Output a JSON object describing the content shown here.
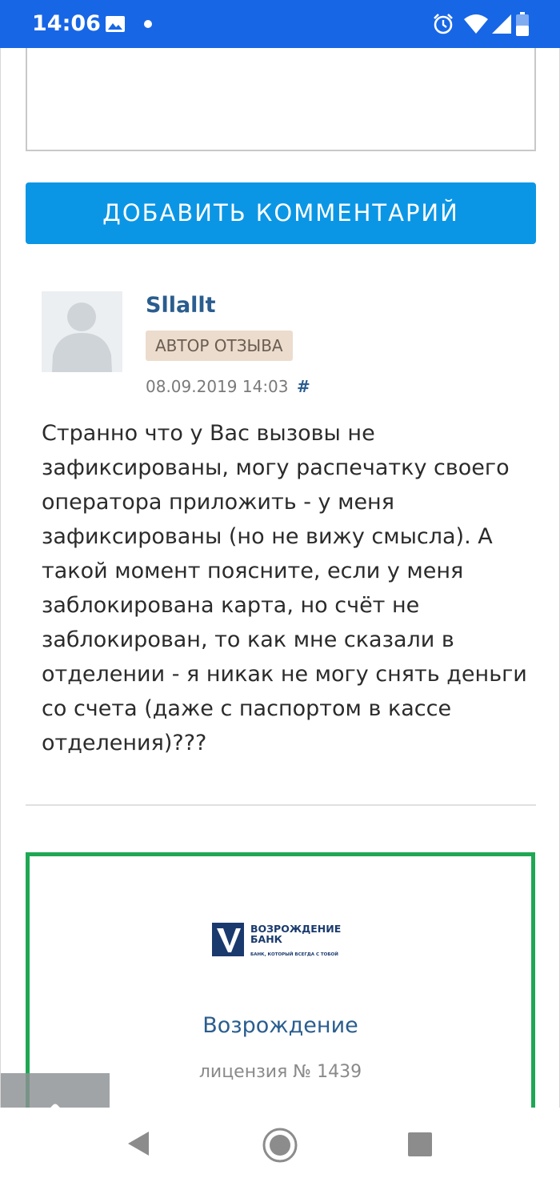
{
  "status_bar": {
    "time": "14:06",
    "background_color": "#1766e6"
  },
  "actions": {
    "add_comment_label": "ДОБАВИТЬ КОММЕНТАРИЙ",
    "button_color": "#0b96e5"
  },
  "comment": {
    "author": "Sllallt",
    "badge": "АВТОР ОТЗЫВА",
    "date": "08.09.2019 14:03",
    "anchor": "#",
    "text_lines": [
      "Странно что у Вас вызовы не",
      "зафиксированы, могу распечатку своего",
      "оператора приложить - у меня",
      "зафиксированы (но не вижу смысла). А",
      "такой момент поясните, если у меня",
      "заблокирована карта, но счёт не",
      "заблокирован, то как мне сказали в",
      "отделении - я никак не могу снять деньги",
      "со счета (даже с паспортом в кассе",
      "отделения)???"
    ]
  },
  "bank": {
    "logo_text_line1": "ВОЗРОЖДЕНИЕ",
    "logo_text_line2": "БАНК",
    "logo_tagline": "БАНК, КОТОРЫЙ ВСЕГДА С ТОБОЙ",
    "name": "Возрождение",
    "license": "лицензия № 1439",
    "border_color": "#1fa754"
  },
  "icons": {
    "scroll_top": "chevron-up-icon",
    "nav_back": "back-triangle-icon",
    "nav_home": "home-circle-icon",
    "nav_recents": "recents-square-icon"
  }
}
